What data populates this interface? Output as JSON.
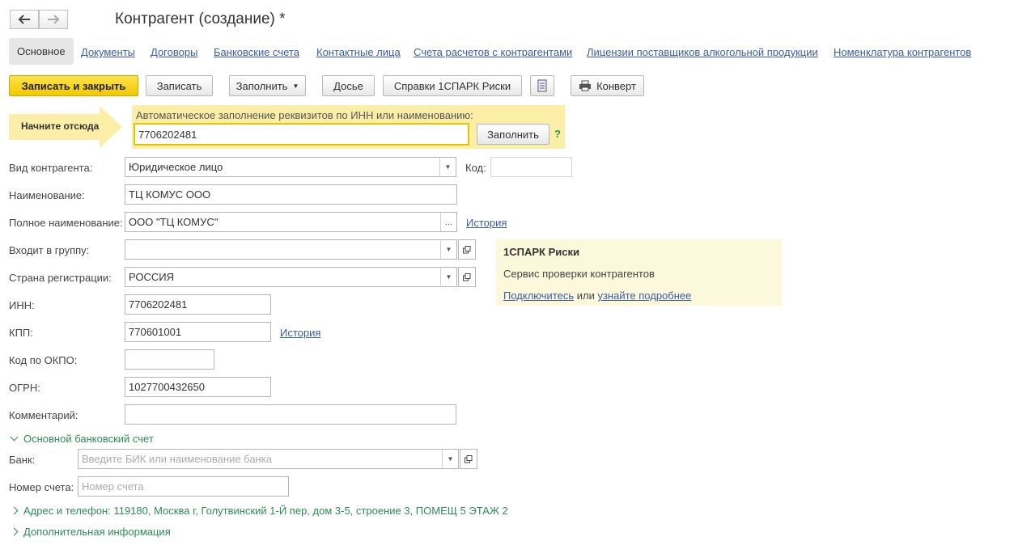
{
  "window": {
    "title": "Контрагент (создание) *"
  },
  "tabs": [
    "Основное",
    "Документы",
    "Договоры",
    "Банковские счета",
    "Контактные лица",
    "Счета расчетов с контрагентами",
    "Лицензии поставщиков алкогольной продукции",
    "Номенклатура контрагентов"
  ],
  "toolbar": {
    "save_close": "Записать и закрыть",
    "save": "Записать",
    "fill": "Заполнить",
    "dossier": "Досье",
    "spark": "Справки 1СПАРК Риски",
    "envelope": "Конверт"
  },
  "autofill": {
    "start_label": "Начните отсюда",
    "caption": "Автоматическое заполнение реквизитов по ИНН или наименованию:",
    "value": "7706202481",
    "button": "Заполнить",
    "help": "?"
  },
  "form": {
    "type_label": "Вид контрагента:",
    "type_value": "Юридическое лицо",
    "code_label": "Код:",
    "code_value": "",
    "name_label": "Наименование:",
    "name_value": "ТЦ КОМУС ООО",
    "fullname_label": "Полное наименование:",
    "fullname_value": "ООО \"ТЦ КОМУС\"",
    "fullname_more": "...",
    "history_link": "История",
    "group_label": "Входит в группу:",
    "group_value": "",
    "country_label": "Страна регистрации:",
    "country_value": "РОССИЯ",
    "inn_label": "ИНН:",
    "inn_value": "7706202481",
    "kpp_label": "КПП:",
    "kpp_value": "770601001",
    "kpp_history": "История",
    "okpo_label": "Код по ОКПО:",
    "okpo_value": "",
    "ogrn_label": "ОГРН:",
    "ogrn_value": "1027700432650",
    "comment_label": "Комментарий:",
    "comment_value": ""
  },
  "bank": {
    "section": "Основной банковский счет",
    "bank_label": "Банк:",
    "bank_placeholder": "Введите БИК или наименование банка",
    "account_label": "Номер счета:",
    "account_placeholder": "Номер счета"
  },
  "spark_panel": {
    "title": "1СПАРК Риски",
    "desc": "Сервис проверки контрагентов",
    "connect": "Подключитесь",
    "or": "или",
    "more": "узнайте подробнее"
  },
  "sections": {
    "address": "Адрес и телефон: 119180, Москва г, Голутвинский 1-Й пер, дом 3-5, строение 3, ПОМЕЩ 5 ЭТАЖ 2",
    "extra": "Дополнительная информация"
  },
  "colors": {
    "accent_yellow": "#f2c900",
    "link": "#3a5ba8",
    "section_green": "#2e8b57",
    "hint_bg": "#fbeea6"
  }
}
